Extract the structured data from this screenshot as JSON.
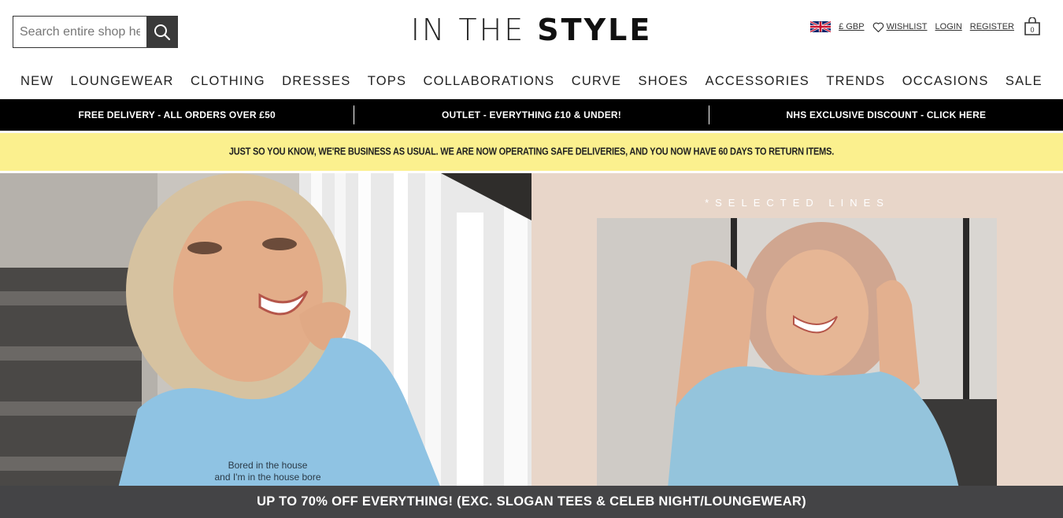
{
  "header": {
    "search_placeholder": "Search entire shop here...",
    "logo_light": "IN THE ",
    "logo_bold": "STYLE",
    "currency": "£ GBP",
    "wishlist": "WISHLIST",
    "login": "LOGIN",
    "register": "REGISTER",
    "bag_count": "0"
  },
  "nav": {
    "items": [
      {
        "label": "NEW"
      },
      {
        "label": "LOUNGEWEAR"
      },
      {
        "label": "CLOTHING"
      },
      {
        "label": "DRESSES"
      },
      {
        "label": "TOPS"
      },
      {
        "label": "COLLABORATIONS"
      },
      {
        "label": "CURVE"
      },
      {
        "label": "SHOES"
      },
      {
        "label": "ACCESSORIES"
      },
      {
        "label": "TRENDS"
      },
      {
        "label": "OCCASIONS"
      },
      {
        "label": "SALE"
      }
    ]
  },
  "promo_bar": {
    "items": [
      {
        "label": "FREE DELIVERY - ALL ORDERS OVER £50"
      },
      {
        "label": "OUTLET - EVERYTHING £10 & UNDER!"
      },
      {
        "label": "NHS EXCLUSIVE DISCOUNT - CLICK HERE"
      }
    ]
  },
  "notice": {
    "text": "JUST SO YOU KNOW, WE'RE BUSINESS AS USUAL. WE ARE NOW OPERATING SAFE DELIVERIES, AND YOU NOW HAVE 60 DAYS TO RETURN ITEMS."
  },
  "hero": {
    "left_sweatshirt_line1": "Bored in the house",
    "left_sweatshirt_line2": "and I'm in the house bore",
    "right_caption": "*SELECTED LINES"
  },
  "bottom_bar": {
    "text": "UP TO 70% OFF EVERYTHING! (EXC. SLOGAN TEES & CELEB NIGHT/LOUNGEWEAR)"
  },
  "colors": {
    "promo_bar_bg": "#000000",
    "notice_bg": "#fbf08e",
    "hero_right_bg": "#e8d6c9",
    "bottom_bar_bg": "#444446"
  }
}
